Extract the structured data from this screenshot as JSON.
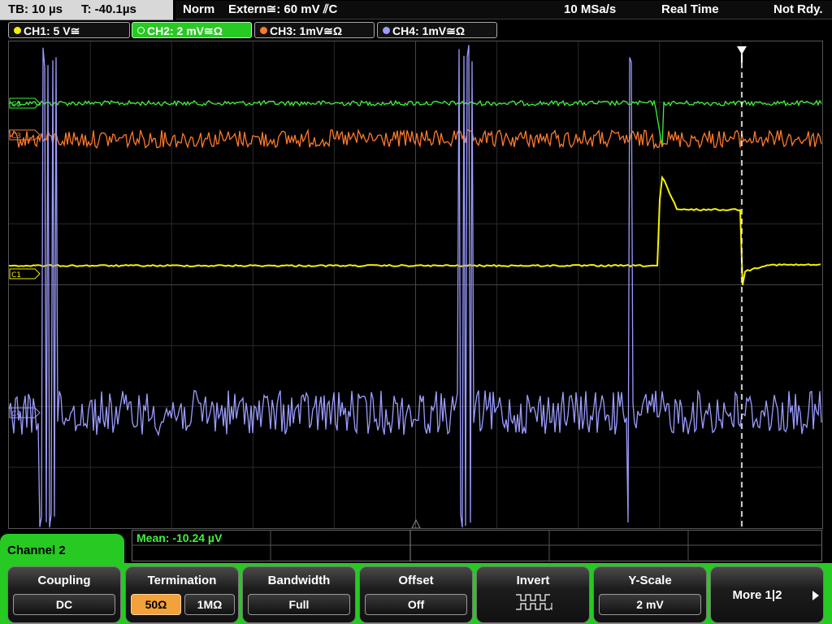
{
  "status": {
    "timebase": "TB: 10 µs",
    "trigger_time": "T: -40.1µs",
    "mode": "Norm",
    "trigger_source": "Extern≅: 60 mV ⫽C",
    "sample_rate": "10 MSa/s",
    "acq_mode": "Real Time",
    "state": "Not Rdy."
  },
  "channels": [
    {
      "label": "CH1: 5 V≅",
      "color": "#f4f000"
    },
    {
      "label": "CH2: 2 mV≅Ω",
      "color": "#3ef23a"
    },
    {
      "label": "CH3: 1mV≅Ω",
      "color": "#ff7a2a"
    },
    {
      "label": "CH4: 1mV≅Ω",
      "color": "#9c9cff"
    }
  ],
  "trace_markers": {
    "ch1": "C1",
    "ch2": "C2",
    "ch3": "C3",
    "ch4": "C4"
  },
  "measurement": {
    "label": "Mean: -10.24 µV"
  },
  "panel": {
    "title": "Channel 2"
  },
  "softkeys": {
    "coupling": {
      "title": "Coupling",
      "value": "DC"
    },
    "termination": {
      "title": "Termination",
      "option_a": "50Ω",
      "option_b": "1MΩ"
    },
    "bandwidth": {
      "title": "Bandwidth",
      "value": "Full"
    },
    "offset": {
      "title": "Offset",
      "value": "Off"
    },
    "invert": {
      "title": "Invert",
      "icon": "inverted-square-wave-icon"
    },
    "yscale": {
      "title": "Y-Scale",
      "value": "2 mV"
    },
    "more": {
      "title": "More 1|2",
      "icon": "right-triangle-icon"
    }
  }
}
